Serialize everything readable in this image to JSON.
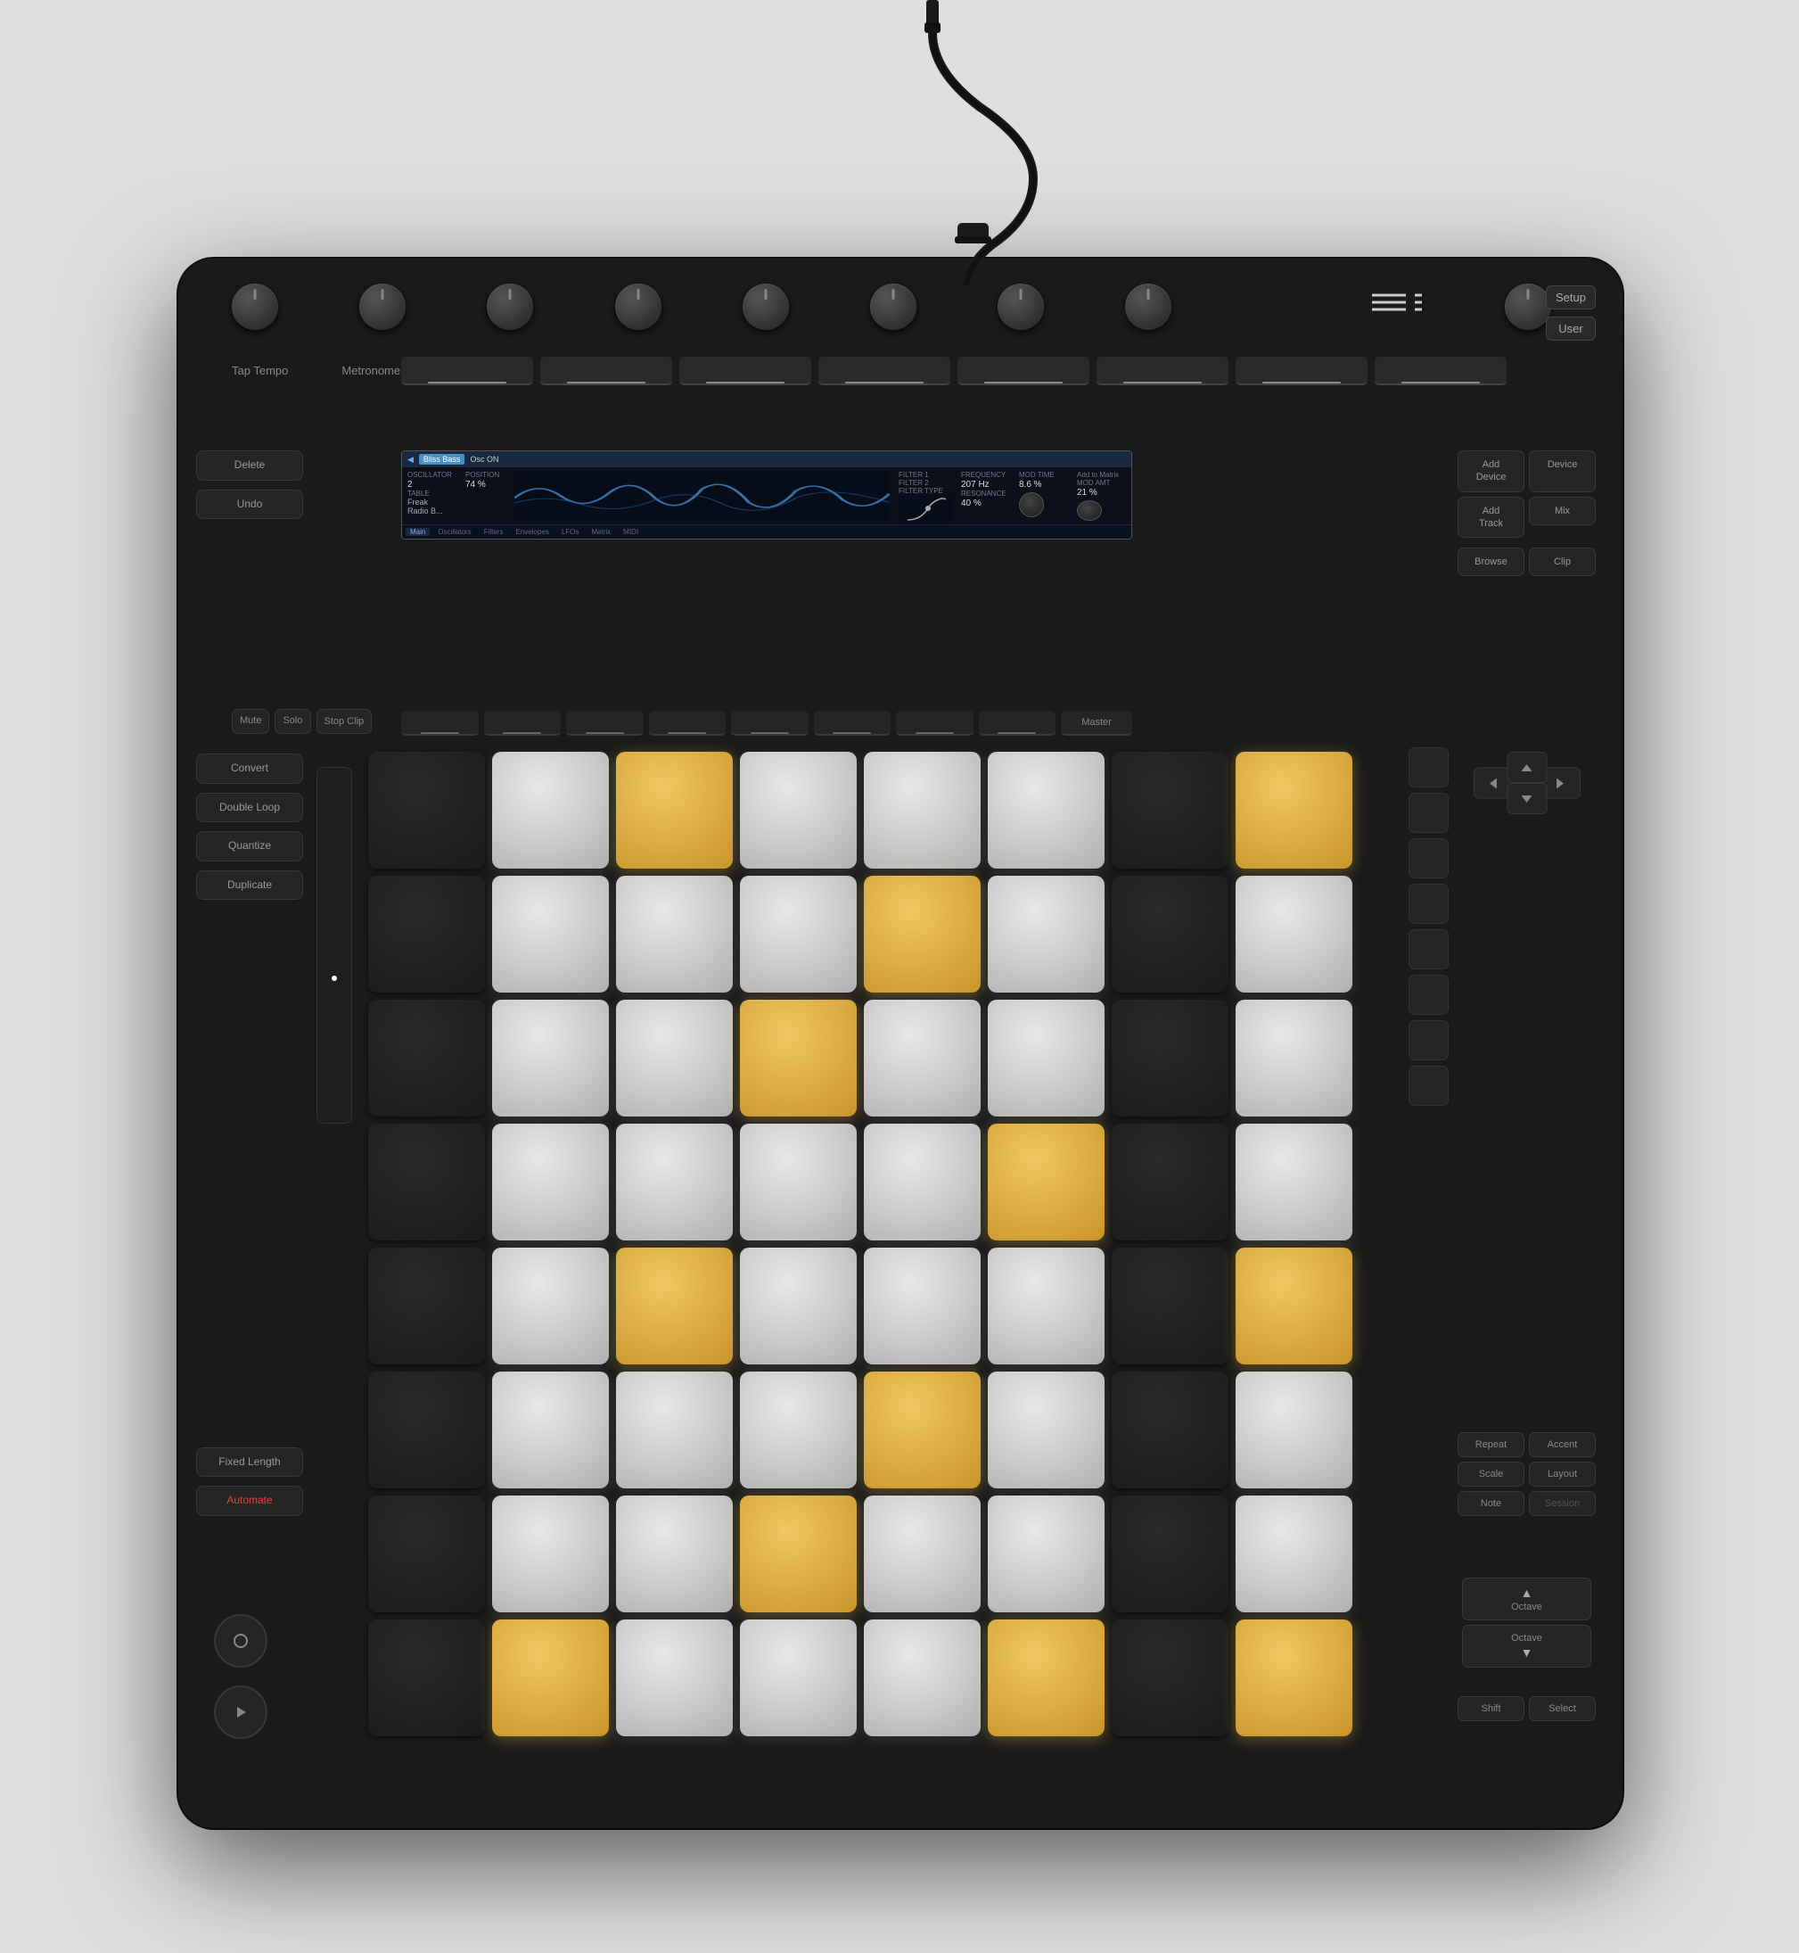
{
  "background": "#dedede",
  "device": {
    "background": "#1a1a1a"
  },
  "header": {
    "setup_label": "Setup",
    "user_label": "User",
    "tap_tempo_label": "Tap Tempo",
    "metronome_label": "Metronome"
  },
  "display": {
    "tag": "Bliss Bass",
    "osc_on": "Osc ON",
    "oscillator_label": "OSCILLATOR",
    "oscillator_value": "2",
    "table_label": "TABLE",
    "table_value": "Freak",
    "radio_label": "Radio B...",
    "position_label": "POSITION",
    "position_value": "74 %",
    "filter1_label": "Filter 1",
    "filter2_label": "Filter 2",
    "filter_type_label": "FILTER TYPE",
    "filter_type_value": "- /1 V",
    "frequency_label": "FREQUENCY",
    "frequency_value": "207 Hz",
    "resonance_label": "RESONANCE",
    "resonance_value": "40 %",
    "mod_time_label": "MOD TIME",
    "mod_time_value": "8.6 %",
    "add_to_matrix_label": "Add to Matrix",
    "mod_amt_label": "MOD AMT",
    "mod_amt_value": "21 %",
    "tabs": [
      "Main",
      "Oscillators",
      "Filters",
      "Envelopes",
      "LFOs",
      "Matrix",
      "MIDI"
    ]
  },
  "right_panel_top": {
    "add_device_label": "Add\nDevice",
    "device_label": "Device",
    "mix_label": "Mix",
    "browse_label": "Browse",
    "clip_label": "Clip",
    "add_track_label": "Add\nTrack"
  },
  "track_row": {
    "master_label": "Master"
  },
  "left_buttons": {
    "delete_label": "Delete",
    "undo_label": "Undo",
    "mute_label": "Mute",
    "solo_label": "Solo",
    "stop_clip_label": "Stop\nClip",
    "convert_label": "Convert",
    "double_loop_label": "Double\nLoop",
    "quantize_label": "Quantize",
    "duplicate_label": "Duplicate",
    "fixed_length_label": "Fixed\nLength",
    "automate_label": "Automate"
  },
  "right_bottom": {
    "repeat_label": "Repeat",
    "accent_label": "Accent",
    "scale_label": "Scale",
    "layout_label": "Layout",
    "note_label": "Note",
    "session_label": "Session",
    "octave_up_label": "Octave",
    "octave_down_label": "Octave",
    "shift_label": "Shift",
    "select_label": "Select"
  },
  "pad_grid": {
    "rows": 8,
    "cols": 8,
    "pattern": [
      [
        "dark",
        "white",
        "gold",
        "white",
        "white",
        "white",
        "dark",
        "gold"
      ],
      [
        "dark",
        "white",
        "white",
        "white",
        "gold",
        "white",
        "dark",
        "white"
      ],
      [
        "dark",
        "white",
        "white",
        "gold",
        "white",
        "white",
        "dark",
        "white"
      ],
      [
        "dark",
        "white",
        "white",
        "white",
        "white",
        "gold",
        "dark",
        "white"
      ],
      [
        "dark",
        "white",
        "gold",
        "white",
        "white",
        "white",
        "dark",
        "gold"
      ],
      [
        "dark",
        "white",
        "white",
        "white",
        "gold",
        "white",
        "dark",
        "white"
      ],
      [
        "dark",
        "white",
        "white",
        "gold",
        "white",
        "white",
        "dark",
        "white"
      ],
      [
        "dark",
        "gold",
        "white",
        "white",
        "white",
        "gold",
        "dark",
        "gold"
      ]
    ]
  },
  "arrows": {
    "left": "‹",
    "right": "›",
    "up": "^",
    "down": "v"
  }
}
